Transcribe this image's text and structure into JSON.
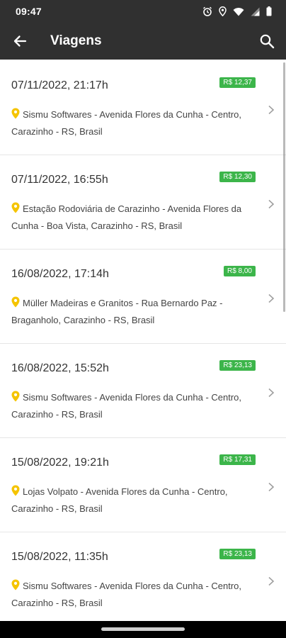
{
  "status_bar": {
    "time": "09:47",
    "icons": [
      "alarm-icon",
      "location-icon",
      "wifi-icon",
      "signal-icon",
      "battery-icon"
    ]
  },
  "app_bar": {
    "title": "Viagens",
    "back_icon": "arrow-left-icon",
    "search_icon": "search-icon"
  },
  "colors": {
    "app_bar_bg": "#303030",
    "price_badge": "#3cb54a",
    "pin": "#f5c400"
  },
  "trips": [
    {
      "date": "07/11/2022, 21:17h",
      "price": "R$ 12,37",
      "address": "Sismu Softwares - Avenida Flores da Cunha - Centro, Carazinho - RS, Brasil"
    },
    {
      "date": "07/11/2022, 16:55h",
      "price": "R$ 12,30",
      "address": "Estação Rodoviária de Carazinho - Avenida Flores da Cunha - Boa Vista, Carazinho - RS, Brasil"
    },
    {
      "date": "16/08/2022, 17:14h",
      "price": "R$ 8,00",
      "address": "Müller Madeiras e Granitos - Rua Bernardo Paz - Braganholo, Carazinho - RS, Brasil"
    },
    {
      "date": "16/08/2022, 15:52h",
      "price": "R$ 23,13",
      "address": "Sismu Softwares - Avenida Flores da Cunha - Centro, Carazinho - RS, Brasil"
    },
    {
      "date": "15/08/2022, 19:21h",
      "price": "R$ 17,31",
      "address": "Lojas Volpato - Avenida Flores da Cunha - Centro, Carazinho - RS, Brasil"
    },
    {
      "date": "15/08/2022, 11:35h",
      "price": "R$ 23,13",
      "address": "Sismu Softwares - Avenida Flores da Cunha - Centro, Carazinho - RS, Brasil"
    }
  ]
}
